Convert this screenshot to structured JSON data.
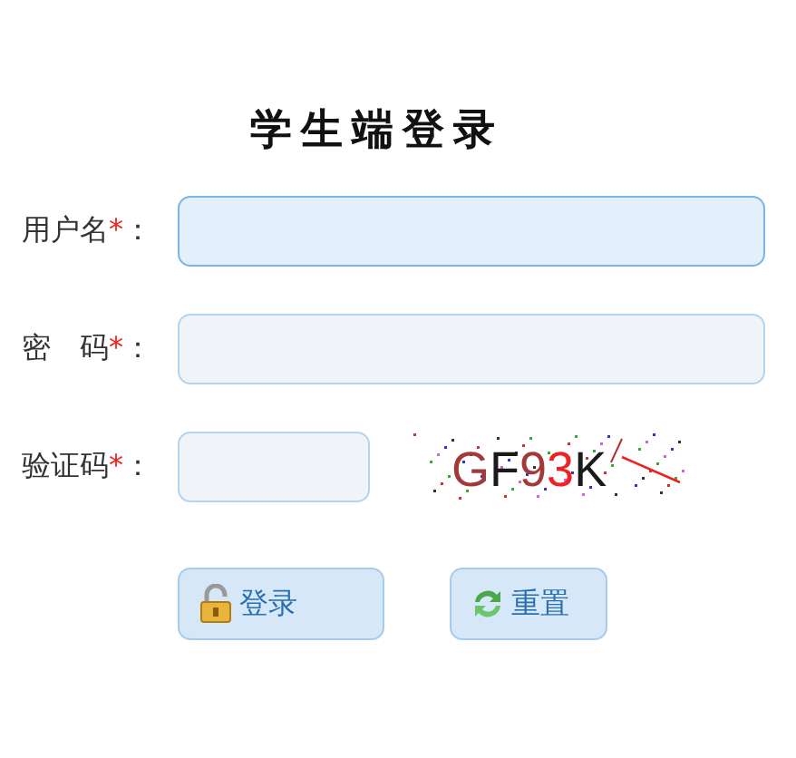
{
  "title": "学生端登录",
  "fields": [
    {
      "label": "用户名",
      "required": true,
      "kind": "text",
      "focused": true
    },
    {
      "label": "密　码",
      "required": true,
      "kind": "password",
      "focused": false
    },
    {
      "label": "验证码",
      "required": true,
      "kind": "captcha",
      "focused": false
    }
  ],
  "captcha": {
    "chars": [
      {
        "char": "G",
        "color": "#a33a3a"
      },
      {
        "char": "F",
        "color": "#1a1a1a"
      },
      {
        "char": "9",
        "color": "#a33a3a"
      },
      {
        "char": "3",
        "color": "#ee2222"
      },
      {
        "char": "K",
        "color": "#1a1a1a"
      }
    ]
  },
  "buttons": [
    {
      "label": "登录",
      "kind": "login"
    },
    {
      "label": "重置",
      "kind": "reset"
    }
  ],
  "required_mark": "*",
  "colon": "："
}
